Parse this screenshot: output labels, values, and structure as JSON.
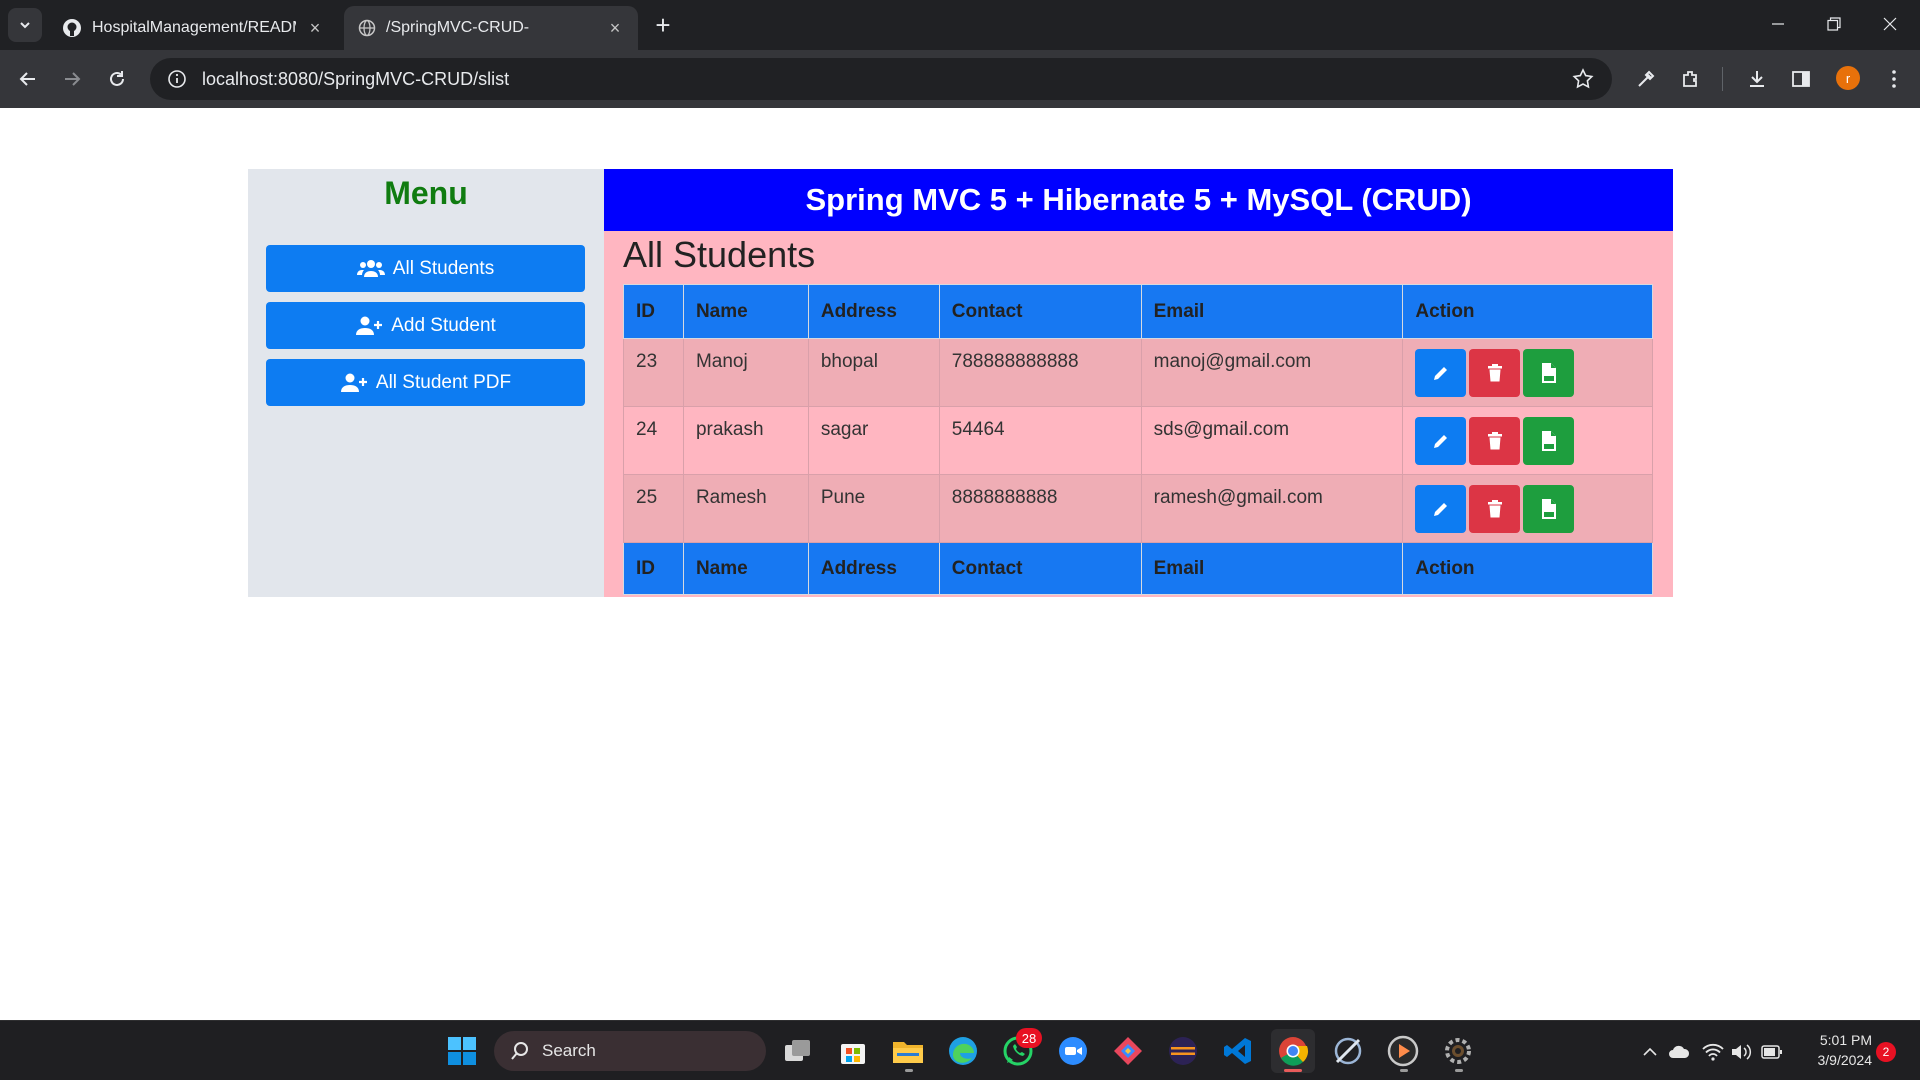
{
  "browser": {
    "tabs": [
      {
        "title": "HospitalManagement/README",
        "icon": "github-icon",
        "active": false
      },
      {
        "title": "/SpringMVC-CRUD-",
        "icon": "globe-icon",
        "active": true
      }
    ],
    "url": "localhost:8080/SpringMVC-CRUD/slist",
    "profile_initial": "r"
  },
  "sidebar": {
    "title": "Menu",
    "items": [
      {
        "label": "All Students",
        "icon": "users-icon"
      },
      {
        "label": "Add Student",
        "icon": "user-plus-icon"
      },
      {
        "label": "All Student PDF",
        "icon": "user-plus-icon"
      }
    ]
  },
  "header": {
    "title": "Spring MVC 5 + Hibernate 5 + MySQL (CRUD)"
  },
  "main": {
    "title": "All Students",
    "columns": [
      "ID",
      "Name",
      "Address",
      "Contact",
      "Email",
      "Action"
    ],
    "rows": [
      [
        "23",
        "Manoj",
        "bhopal",
        "788888888888",
        "manoj@gmail.com"
      ],
      [
        "24",
        "prakash",
        "sagar",
        "54464",
        "sds@gmail.com"
      ],
      [
        "25",
        "Ramesh",
        "Pune",
        "8888888888",
        "ramesh@gmail.com"
      ]
    ],
    "action_icons": [
      "pencil-icon",
      "trash-icon",
      "file-pdf-icon"
    ]
  },
  "taskbar": {
    "search_label": "Search",
    "whatsapp_badge": "28",
    "time": "5:01 PM",
    "date": "3/9/2024",
    "notifications": "2"
  },
  "colors": {
    "header_bg": "#0000ff",
    "menu_title": "#107c10",
    "primary": "#0d7cf2",
    "danger": "#dc3545",
    "success": "#1e9e3e",
    "content_bg": "#ffb6c1",
    "sidebar_bg": "#e2e6ec"
  }
}
